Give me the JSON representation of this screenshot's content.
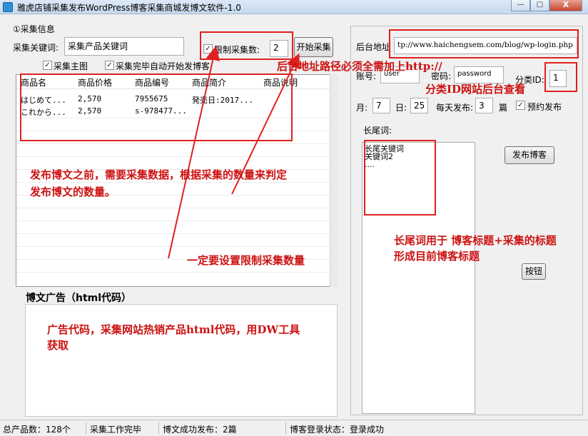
{
  "window": {
    "title": "雅虎店铺采集发布WordPress博客采集商城发博文软件-1.0",
    "min_glyph": "—",
    "max_glyph": "□",
    "close_glyph": "X"
  },
  "collect": {
    "group_title": "①采集信息",
    "keyword_label": "采集关键词:",
    "keyword_value": "采集产品关键词",
    "limit_label": "限制采集数:",
    "limit_value": "2",
    "start_button": "开始采集",
    "collect_main_image_label": "采集主图",
    "auto_publish_label": "采集完毕自动开始发博客",
    "columns": [
      "商品名",
      "商品价格",
      "商品编号",
      "商品简介",
      "商品说明"
    ],
    "rows": [
      [
        "はじめて...",
        "2,570",
        "7955675",
        "発売日:2017...",
        ""
      ],
      [
        "これから...",
        "2,570",
        "s-978477...",
        "",
        ""
      ]
    ]
  },
  "ad": {
    "title": "博文广告（html代码）"
  },
  "publish": {
    "backend_label": "后台地址",
    "backend_url": "tp://www.haichengsem.com/blog/wp-login.php",
    "account_label": "账号:",
    "account_value": "user",
    "password_label": "密码:",
    "password_value": "password",
    "category_label": "分类ID:",
    "category_value": "1",
    "month_label": "月:",
    "month_value": "7",
    "day_label": "日:",
    "day_value": "25",
    "daily_label": "每天发布:",
    "daily_value": "3",
    "daily_unit": "篇",
    "schedule_label": "预约发布",
    "longtail_label": "长尾词:",
    "longtail_lines": [
      "长尾关键词",
      "关键词2",
      "...."
    ],
    "publish_button": "发布博客",
    "generic_button": "按钮"
  },
  "checks": {
    "checked_glyph": "✓"
  },
  "status": {
    "total": "总产品数：128个",
    "collect_status": "采集工作完毕",
    "publish_status": "博文成功发布：2篇",
    "login_status": "博客登录状态：登录成功"
  },
  "annotations": {
    "backend_note": "后台地址路径必须全需加上http://",
    "category_note": "分类ID网站后台查看",
    "collect_note_1": "发布博文之前，需要采集数据，根据采集的数量来判定",
    "collect_note_2": "发布博文的数量。",
    "limit_note": "一定要设置限制采集数量",
    "longtail_note_1": "长尾词用于 博客标题+采集的标题",
    "longtail_note_2": "形成目前博客标题",
    "ad_note_1": "广告代码，采集网站热销产品html代码，用DW工具",
    "ad_note_2": "获取"
  },
  "colors": {
    "annotation_red": "#e02020",
    "titlebar": "#c7d9ee"
  }
}
